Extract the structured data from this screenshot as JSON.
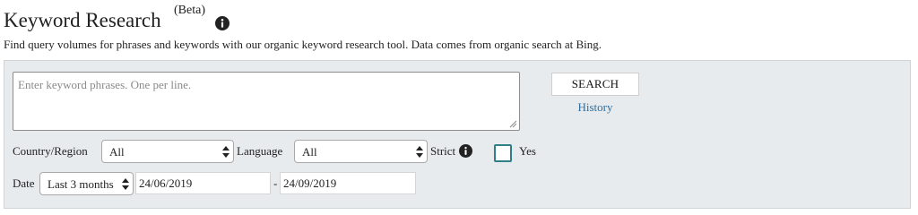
{
  "header": {
    "title": "Keyword Research",
    "beta": "(Beta)",
    "info_icon": "info-circle-icon",
    "subtitle": "Find query volumes for phrases and keywords with our organic keyword research tool. Data comes from organic search at Bing."
  },
  "form": {
    "keywords_placeholder": "Enter keyword phrases. One per line.",
    "search_label": "SEARCH",
    "history_label": "History",
    "country_label": "Country/Region",
    "country_value": "All",
    "language_label": "Language",
    "language_value": "All",
    "strict_label": "Strict",
    "strict_checked": false,
    "yes_label": "Yes",
    "date_label": "Date",
    "date_range_value": "Last 3 months",
    "date_from": "24/06/2019",
    "date_separator": "-",
    "date_to": "24/09/2019"
  },
  "colors": {
    "panel_bg": "#e8ebee",
    "link": "#2a6fa0",
    "checkbox_border": "#2f7f88"
  }
}
